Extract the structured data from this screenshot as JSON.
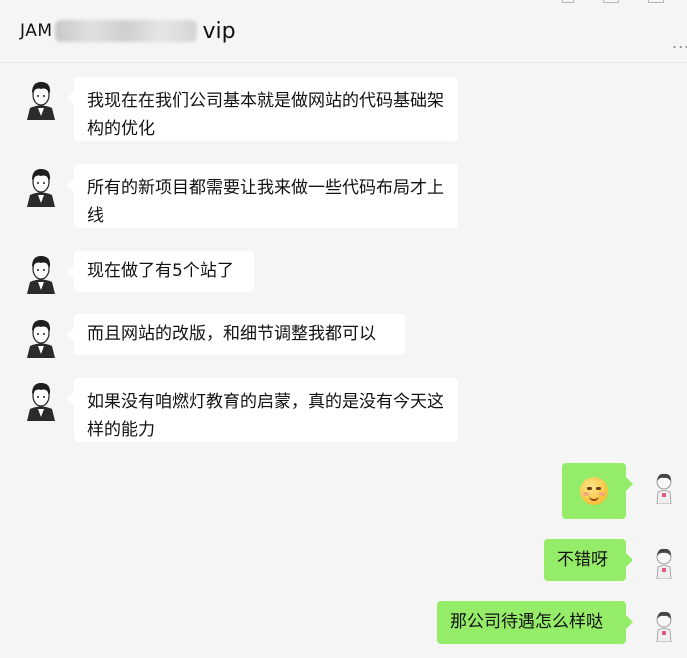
{
  "header": {
    "title_prefix": "JAM",
    "title_suffix": "vip",
    "more_label": "..."
  },
  "messages": [
    {
      "side": "left",
      "text": "我现在在我们公司基本就是做网站的代码基础架构的优化"
    },
    {
      "side": "left",
      "text": "所有的新项目都需要让我来做一些代码布局才上线"
    },
    {
      "side": "left",
      "text": "现在做了有5个站了"
    },
    {
      "side": "left",
      "text": "而且网站的改版，和细节调整我都可以"
    },
    {
      "side": "left",
      "text": "如果没有咱燃灯教育的启蒙，真的是没有今天这样的能力"
    },
    {
      "side": "right",
      "text": "",
      "emoji": "shy-smile-emoji"
    },
    {
      "side": "right",
      "text": "不错呀"
    },
    {
      "side": "right",
      "text": "那公司待遇怎么样哒"
    }
  ],
  "colors": {
    "background": "#f5f5f5",
    "incoming_bubble": "#ffffff",
    "outgoing_bubble": "#95ec69"
  }
}
